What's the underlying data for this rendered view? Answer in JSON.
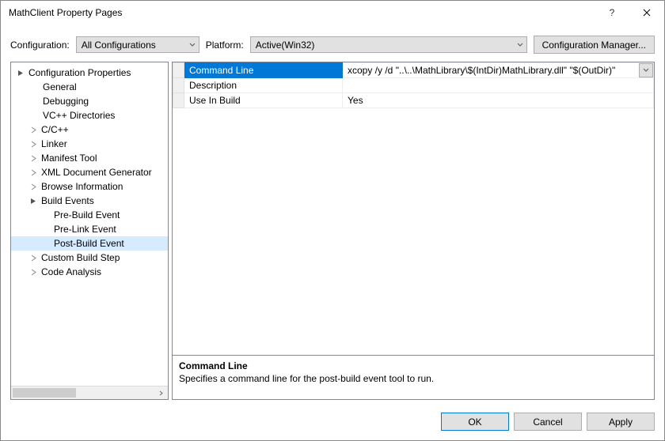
{
  "window": {
    "title": "MathClient Property Pages"
  },
  "configrow": {
    "configuration_label": "Configuration:",
    "configuration_value": "All Configurations",
    "platform_label": "Platform:",
    "platform_value": "Active(Win32)",
    "config_manager_label": "Configuration Manager..."
  },
  "tree": {
    "root": "Configuration Properties",
    "general": "General",
    "debugging": "Debugging",
    "vc_dirs": "VC++ Directories",
    "ccpp": "C/C++",
    "linker": "Linker",
    "manifest": "Manifest Tool",
    "xml_doc": "XML Document Generator",
    "browse_info": "Browse Information",
    "build_events": "Build Events",
    "pre_build": "Pre-Build Event",
    "pre_link": "Pre-Link Event",
    "post_build": "Post-Build Event",
    "custom_build": "Custom Build Step",
    "code_analysis": "Code Analysis"
  },
  "grid": {
    "rows": {
      "command_line": {
        "name": "Command Line",
        "value": "xcopy /y /d \"..\\..\\MathLibrary\\$(IntDir)MathLibrary.dll\" \"$(OutDir)\""
      },
      "description": {
        "name": "Description",
        "value": ""
      },
      "use_in_build": {
        "name": "Use In Build",
        "value": "Yes"
      }
    }
  },
  "help": {
    "name": "Command Line",
    "desc": "Specifies a command line for the post-build event tool to run."
  },
  "buttons": {
    "ok": "OK",
    "cancel": "Cancel",
    "apply": "Apply"
  }
}
